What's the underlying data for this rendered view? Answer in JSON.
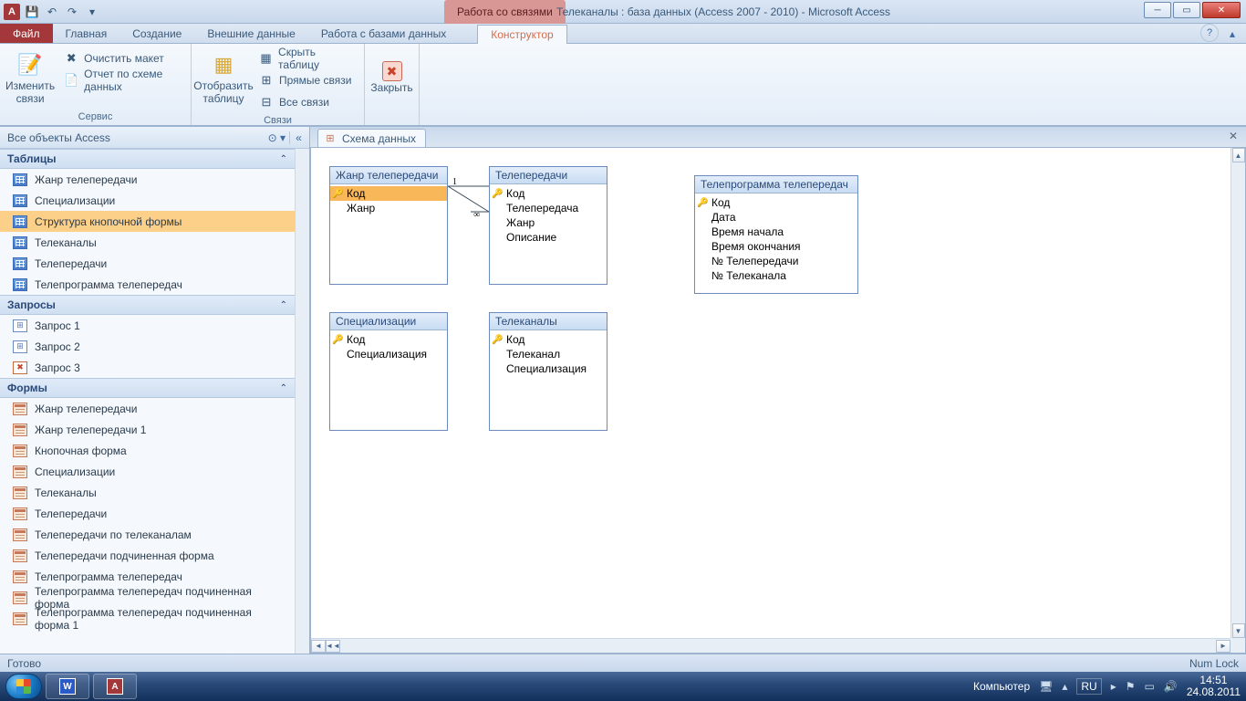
{
  "titlebar": {
    "context_tab": "Работа со связями",
    "title": "Телеканалы : база данных (Access 2007 - 2010)  -  Microsoft Access"
  },
  "ribbon_tabs": {
    "file": "Файл",
    "items": [
      "Главная",
      "Создание",
      "Внешние данные",
      "Работа с базами данных"
    ],
    "active": "Конструктор"
  },
  "ribbon": {
    "group1": {
      "label": "Сервис",
      "edit_relations": "Изменить связи",
      "clear_layout": "Очистить макет",
      "relation_report": "Отчет по схеме данных"
    },
    "group2": {
      "label": "Связи",
      "show_table": "Отобразить таблицу",
      "hide_table": "Скрыть таблицу",
      "direct_relations": "Прямые связи",
      "all_relations": "Все связи"
    },
    "group3": {
      "close": "Закрыть"
    }
  },
  "nav": {
    "header": "Все объекты Access",
    "groups": {
      "tables": {
        "label": "Таблицы",
        "items": [
          "Жанр телепередачи",
          "Специализации",
          "Структура кнопочной формы",
          "Телеканалы",
          "Телепередачи",
          "Телепрограмма телепередач"
        ]
      },
      "queries": {
        "label": "Запросы",
        "items": [
          "Запрос 1",
          "Запрос 2",
          "Запрос 3"
        ]
      },
      "forms": {
        "label": "Формы",
        "items": [
          "Жанр телепередачи",
          "Жанр телепередачи 1",
          "Кнопочная форма",
          "Специализации",
          "Телеканалы",
          "Телепередачи",
          "Телепередачи по телеканалам",
          "Телепередачи подчиненная форма",
          "Телепрограмма телепередач",
          "Телепрограмма телепередач подчиненная форма",
          "Телепрограмма телепередач подчиненная форма 1"
        ]
      }
    }
  },
  "document": {
    "tab": "Схема данных",
    "tables": {
      "genre": {
        "title": "Жанр телепередачи",
        "fields": [
          "Код",
          "Жанр"
        ],
        "key_index": 0,
        "selected": 0
      },
      "shows": {
        "title": "Телепередачи",
        "fields": [
          "Код",
          "Телепередача",
          "Жанр",
          "Описание"
        ],
        "key_index": 0
      },
      "schedule": {
        "title": "Телепрограмма телепередач",
        "fields": [
          "Код",
          "Дата",
          "Время начала",
          "Время окончания",
          "№ Телепередачи",
          "№ Телеканала"
        ],
        "key_index": 0
      },
      "spec": {
        "title": "Специализации",
        "fields": [
          "Код",
          "Специализация"
        ],
        "key_index": 0
      },
      "channels": {
        "title": "Телеканалы",
        "fields": [
          "Код",
          "Телеканал",
          "Специализация"
        ],
        "key_index": 0
      }
    }
  },
  "status": {
    "ready": "Готово",
    "numlock": "Num Lock"
  },
  "taskbar": {
    "computer": "Компьютер",
    "lang": "RU",
    "time": "14:51",
    "date": "24.08.2011"
  }
}
